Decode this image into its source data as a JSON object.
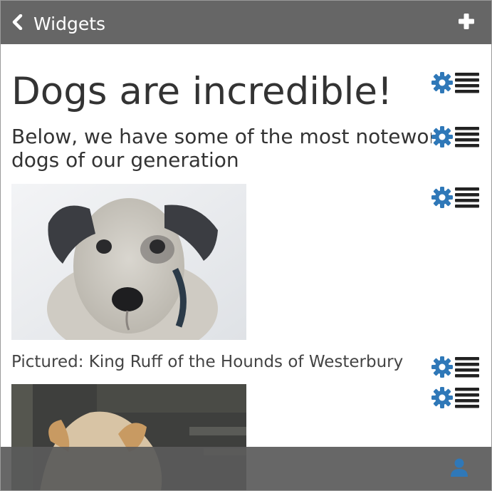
{
  "header": {
    "title": "Widgets",
    "back_icon": "chevron-left-icon",
    "add_icon": "plus-icon"
  },
  "widgets": {
    "heading": "Dogs are incredible!",
    "subheading_line1": "Below, we have some of the most noteworthy",
    "subheading_line2": "dogs of our generation",
    "image1_alt": "dog photo",
    "caption": "Pictured: King Ruff of the Hounds of Westerbury",
    "image2_alt": "dog photo"
  },
  "widget_controls": {
    "settings_icon": "gear-icon",
    "drag_icon": "drag-handle-icon"
  },
  "footer": {
    "user_icon": "user-icon"
  },
  "colors": {
    "topbar": "#666666",
    "bottombar": "#5a5a5a",
    "accent": "#2f78b8",
    "handle": "#222222"
  }
}
